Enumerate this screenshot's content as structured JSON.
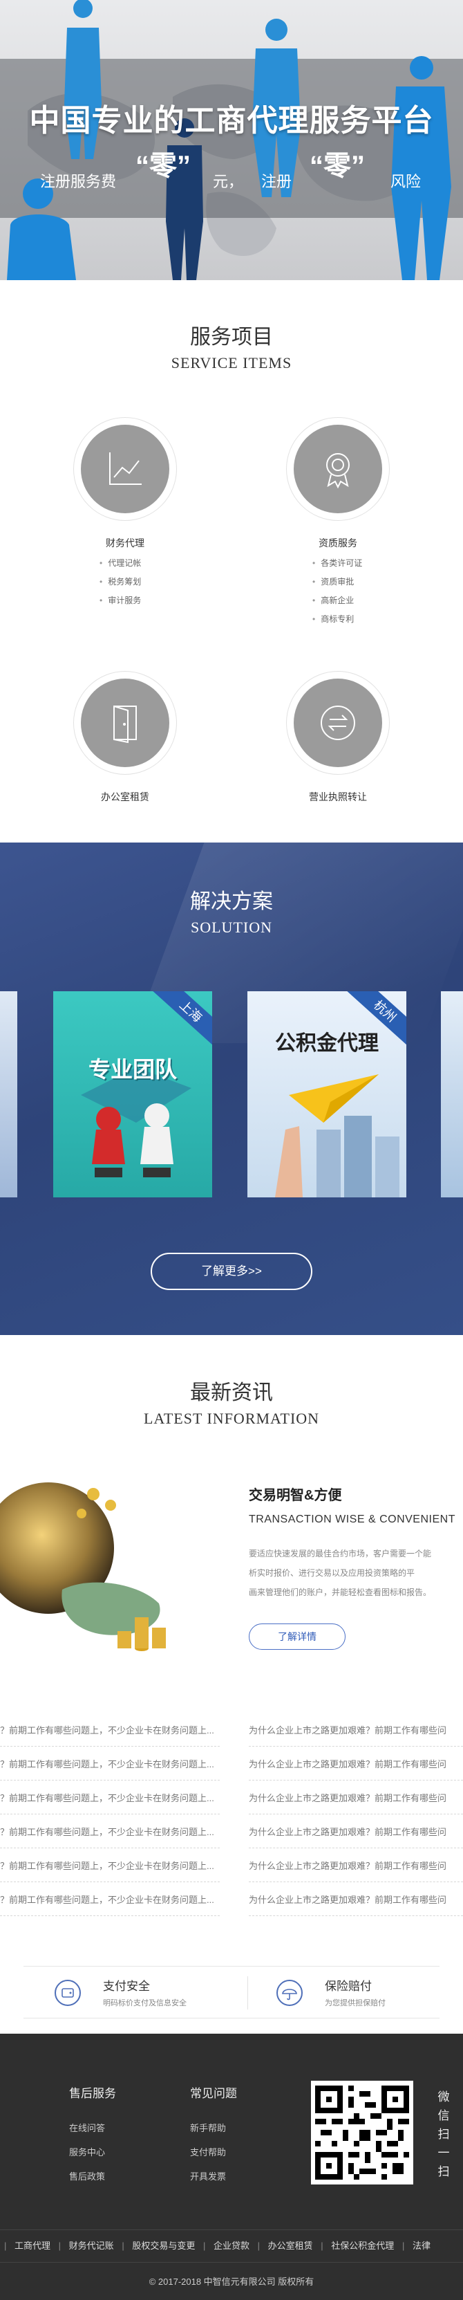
{
  "hero": {
    "headline": "中国专业的工商代理服务平台",
    "sub_1": "注册服务费",
    "sub_q1": "“零”",
    "sub_2": "元，",
    "sub_3": "注册",
    "sub_q2": "“零”",
    "sub_4": "风险"
  },
  "services": {
    "title_cn": "服务项目",
    "title_en": "SERVICE ITEMS",
    "items": [
      {
        "name": "财务代理",
        "icon": "chart-icon",
        "bullets": [
          "代理记帐",
          "税务筹划",
          "审计服务"
        ]
      },
      {
        "name": "资质服务",
        "icon": "award-icon",
        "bullets": [
          "各类许可证",
          "资质审批",
          "高新企业",
          "商标专利"
        ]
      },
      {
        "name": "办公室租赁",
        "icon": "door-icon",
        "bullets": []
      },
      {
        "name": "营业执照转让",
        "icon": "exchange-icon",
        "bullets": []
      }
    ]
  },
  "solution": {
    "title_cn": "解决方案",
    "title_en": "SOLUTION",
    "cards": [
      {
        "ribbon": "上海",
        "caption": "专业团队"
      },
      {
        "ribbon": "杭州",
        "caption": "公积金代理"
      }
    ],
    "more_label": "了解更多>>"
  },
  "news": {
    "title_cn": "最新资讯",
    "title_en": "LATEST INFORMATION",
    "feature": {
      "title": "交易明智&方便",
      "title_en": "TRANSACTION WISE & CONVENIENT",
      "desc_lines": [
        "要适应快速发展的最佳合约市场，客户需要一个能",
        "析实时报价、进行交易以及应用投资策略的平",
        "画来管理他们的账户，并能轻松查看图标和报告。"
      ],
      "detail_label": "了解详情"
    },
    "rows": [
      {
        "left": "？前期工作有哪些问题上，不少企业卡在财务问题上...",
        "right": "为什么企业上市之路更加艰难？前期工作有哪些问"
      },
      {
        "left": "？前期工作有哪些问题上，不少企业卡在财务问题上...",
        "right": "为什么企业上市之路更加艰难？前期工作有哪些问"
      },
      {
        "left": "？前期工作有哪些问题上，不少企业卡在财务问题上...",
        "right": "为什么企业上市之路更加艰难？前期工作有哪些问"
      },
      {
        "left": "？前期工作有哪些问题上，不少企业卡在财务问题上...",
        "right": "为什么企业上市之路更加艰难？前期工作有哪些问"
      },
      {
        "left": "？前期工作有哪些问题上，不少企业卡在财务问题上...",
        "right": "为什么企业上市之路更加艰难？前期工作有哪些问"
      },
      {
        "left": "？前期工作有哪些问题上，不少企业卡在财务问题上...",
        "right": "为什么企业上市之路更加艰难？前期工作有哪些问"
      }
    ]
  },
  "guarantee": {
    "pay_title": "支付安全",
    "pay_desc": "明码标价支付及信息安全",
    "comp_title": "保险赔付",
    "comp_desc": "为您提供担保赔付"
  },
  "footer": {
    "col1_title": "售后服务",
    "col1_links": [
      "在线问答",
      "服务中心",
      "售后政策"
    ],
    "col2_title": "常见问题",
    "col2_links": [
      "新手帮助",
      "支付帮助",
      "开具发票"
    ],
    "scan_chars": [
      "微",
      "信",
      "扫",
      "一",
      "扫"
    ],
    "links": [
      "工商代理",
      "财务代记账",
      "股权交易与变更",
      "企业贷款",
      "办公室租赁",
      "社保公积金代理",
      "法律"
    ],
    "copyright": "© 2017-2018 中智信元有限公司 版权所有"
  },
  "colors": {
    "accent_blue": "#2f5bb8",
    "solution_bg": "#2e4479",
    "footer_bg": "#2f2f2f",
    "icon_gray": "#9b9b9b"
  }
}
